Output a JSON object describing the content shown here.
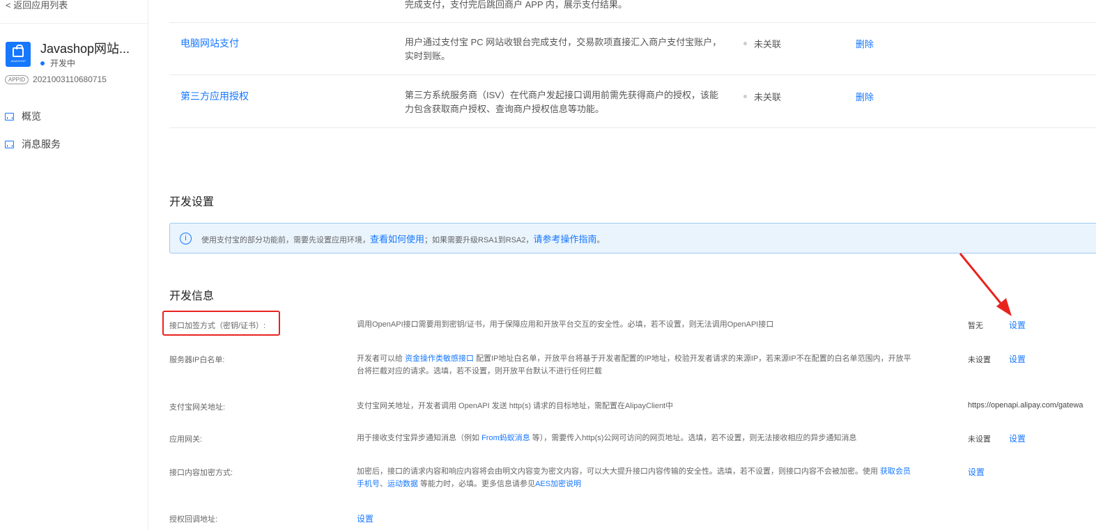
{
  "sidebar": {
    "back_label": "< 返回应用列表",
    "app_name": "Javashop网站...",
    "logo_text": "JAVASHOP",
    "status": "开发中",
    "appid_badge": "APPID",
    "appid": "2021003110680715",
    "nav": [
      {
        "label": "概览",
        "icon": "dashboard-icon"
      },
      {
        "label": "消息服务",
        "icon": "message-service-icon"
      }
    ]
  },
  "products": {
    "top_partial_desc": "完成支付，支付完后跳回商户 APP 内，展示支付结果。",
    "rows": [
      {
        "name": "电脑网站支付",
        "desc": "用户通过支付宝 PC 网站收银台完成支付，交易款项直接汇入商户支付宝账户，实时到账。",
        "state": "未关联",
        "action": "删除"
      },
      {
        "name": "第三方应用授权",
        "desc": "第三方系统服务商（ISV）在代商户发起接口调用前需先获得商户的授权，该能力包含获取商户授权、查询商户授权信息等功能。",
        "state": "未关联",
        "action": "删除"
      }
    ]
  },
  "dev_settings": {
    "title": "开发设置",
    "notice_prefix": "使用支付宝的部分功能前，需要先设置应用环境，",
    "notice_link1": "查看如何使用",
    "notice_mid": "；如果需要升级RSA1到RSA2，",
    "notice_link2": "请参考操作指南",
    "notice_suffix": "。"
  },
  "dev_info": {
    "title": "开发信息",
    "rows": {
      "sign": {
        "label": "接口加签方式（密钥/证书）:",
        "desc": "调用OpenAPI接口需要用到密钥/证书，用于保障应用和开放平台交互的安全性。必填，若不设置，则无法调用OpenAPI接口",
        "value": "暂无",
        "action": "设置"
      },
      "ip": {
        "label": "服务器IP白名单:",
        "desc_pre": "开发者可以给 ",
        "desc_link": "资金操作类敏感接口",
        "desc_post": " 配置IP地址白名单，开放平台将基于开发者配置的IP地址，校验开发者请求的来源IP，若来源IP不在配置的白名单范围内，开放平台将拦截对应的请求。选填，若不设置，则开放平台默认不进行任何拦截",
        "value": "未设置",
        "action": "设置"
      },
      "gateway": {
        "label": "支付宝网关地址:",
        "desc": "支付宝网关地址，开发者调用 OpenAPI 发送 http(s) 请求的目标地址，需配置在AlipayClient中",
        "value": "https://openapi.alipay.com/gatewa"
      },
      "app_gateway": {
        "label": "应用网关:",
        "desc_pre": "用于接收支付宝异步通知消息（例如 ",
        "desc_link": "From蚂蚁消息",
        "desc_post": " 等），需要传入http(s)公网可访问的网页地址。选填，若不设置，则无法接收相应的异步通知消息",
        "value": "未设置",
        "action": "设置"
      },
      "encrypt": {
        "label": "接口内容加密方式:",
        "desc_pre": "加密后，接口的请求内容和响应内容将会由明文内容变为密文内容，可以大大提升接口内容传输的安全性。选填，若不设置，则接口内容不会被加密。使用 ",
        "desc_link1": "获取会员手机号",
        "desc_sep": "、",
        "desc_link2": "运动数据",
        "desc_mid": " 等能力时，必填。更多信息请参见",
        "desc_link3": "AES加密说明",
        "action": "设置"
      },
      "callback": {
        "label": "授权回调地址:",
        "action": "设置"
      }
    }
  },
  "colors": {
    "accent": "#1677ff",
    "highlight": "#e8231e",
    "notice_bg": "#eaf4fd"
  }
}
